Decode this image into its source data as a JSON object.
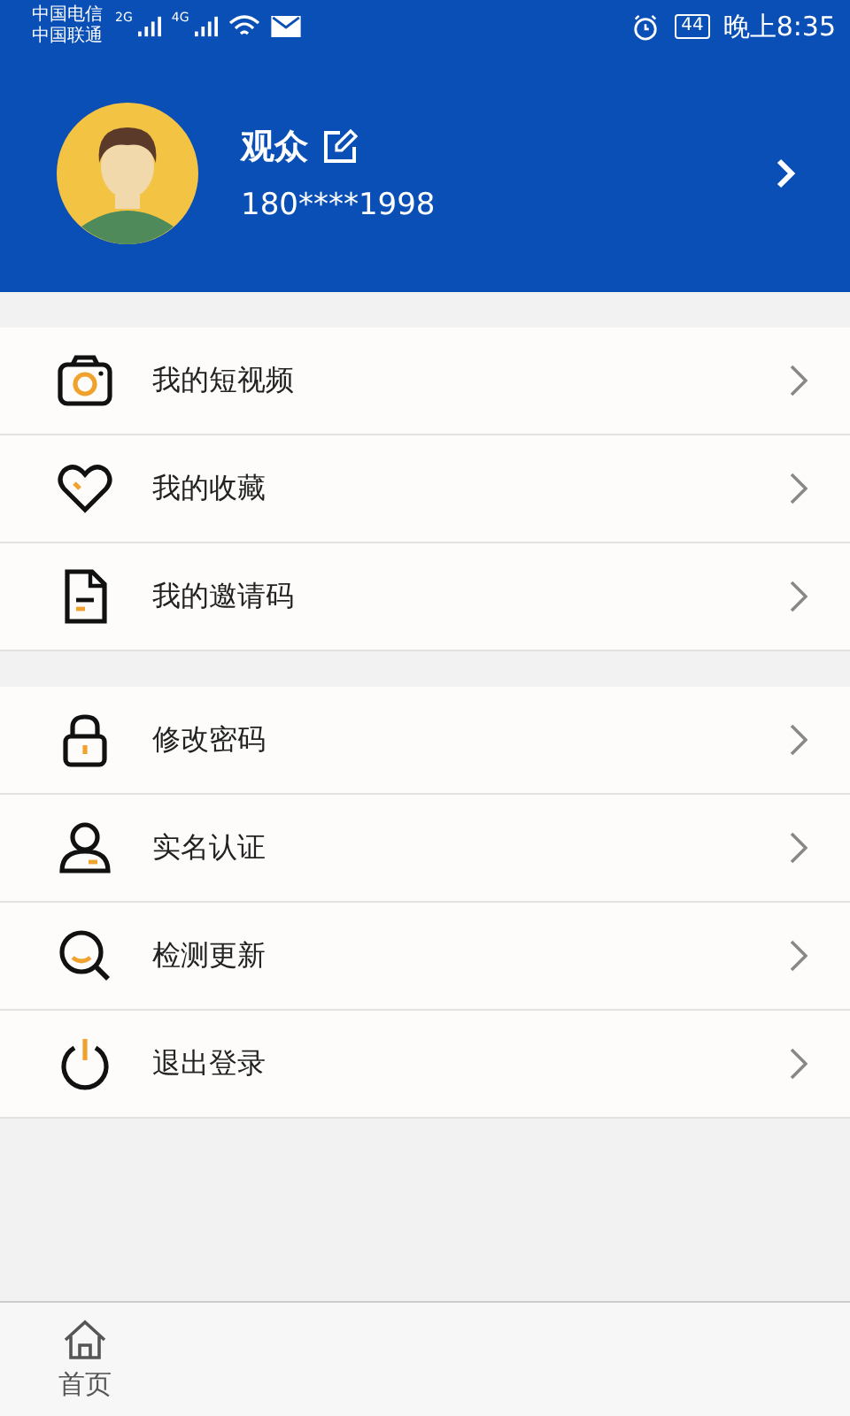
{
  "status_bar": {
    "carriers": [
      "中国电信",
      "中国联通"
    ],
    "networks": [
      "2G",
      "4G"
    ],
    "battery": "44",
    "time": "晚上8:35"
  },
  "profile": {
    "name": "观众",
    "phone": "180****1998"
  },
  "menu_groups": [
    {
      "items": [
        {
          "label": "我的短视频"
        },
        {
          "label": "我的收藏"
        },
        {
          "label": "我的邀请码"
        }
      ]
    },
    {
      "items": [
        {
          "label": "修改密码"
        },
        {
          "label": "实名认证"
        },
        {
          "label": "检测更新"
        },
        {
          "label": "退出登录"
        }
      ]
    }
  ],
  "tab_bar": {
    "tabs": [
      {
        "label": "首页",
        "selected": false
      }
    ]
  }
}
